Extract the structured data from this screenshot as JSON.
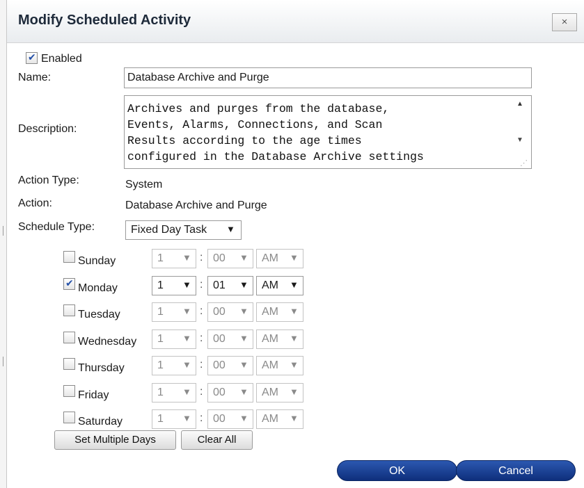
{
  "dialog": {
    "title": "Modify Scheduled Activity",
    "close_label": "×"
  },
  "form": {
    "enabled_label": "Enabled",
    "enabled_checked": true,
    "name_label": "Name:",
    "name_value": "Database Archive and Purge",
    "description_label": "Description:",
    "description_value": "Archives and purges from the database,\nEvents, Alarms, Connections, and Scan\nResults according to the age times\nconfigured in the Database Archive settings",
    "action_type_label": "Action Type:",
    "action_type_value": "System",
    "action_label": "Action:",
    "action_value": "Database Archive and Purge",
    "schedule_type_label": "Schedule Type:",
    "schedule_type_value": "Fixed Day Task"
  },
  "days": [
    {
      "name": "Sunday",
      "checked": false,
      "hour": "1",
      "minute": "00",
      "ampm": "AM"
    },
    {
      "name": "Monday",
      "checked": true,
      "hour": "1",
      "minute": "01",
      "ampm": "AM"
    },
    {
      "name": "Tuesday",
      "checked": false,
      "hour": "1",
      "minute": "00",
      "ampm": "AM"
    },
    {
      "name": "Wednesday",
      "checked": false,
      "hour": "1",
      "minute": "00",
      "ampm": "AM"
    },
    {
      "name": "Thursday",
      "checked": false,
      "hour": "1",
      "minute": "00",
      "ampm": "AM"
    },
    {
      "name": "Friday",
      "checked": false,
      "hour": "1",
      "minute": "00",
      "ampm": "AM"
    },
    {
      "name": "Saturday",
      "checked": false,
      "hour": "1",
      "minute": "00",
      "ampm": "AM"
    }
  ],
  "time_separator": ":",
  "buttons": {
    "set_multiple_days": "Set Multiple Days",
    "clear_all": "Clear All",
    "ok": "OK",
    "cancel": "Cancel"
  },
  "colors": {
    "primary_button": "#1a3f92",
    "disabled_text": "#8a8a8a",
    "checkbox_mark": "#2450a8"
  },
  "icons": {
    "close": "close-icon",
    "dropdown": "chevron-down-icon",
    "scroll_up": "scroll-up-icon",
    "scroll_down": "scroll-down-icon",
    "check": "checkmark-icon"
  }
}
